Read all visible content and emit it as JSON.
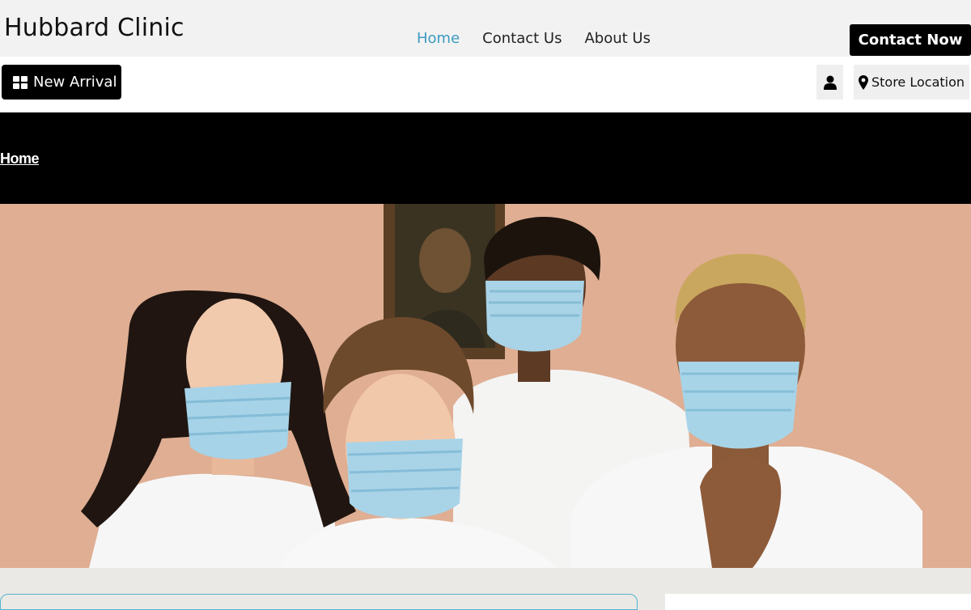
{
  "header": {
    "brand": "Hubbard Clinic",
    "nav": [
      {
        "label": "Home",
        "active": true
      },
      {
        "label": "Contact Us",
        "active": false
      },
      {
        "label": "About Us",
        "active": false
      }
    ],
    "contact_now_label": "Contact Now"
  },
  "subbar": {
    "new_arrival_label": "New Arrival",
    "new_arrival_icon": "grid-icon",
    "account_icon": "user-icon",
    "store_location_label": "Store Location",
    "store_location_icon": "map-marker-icon"
  },
  "banner": {
    "breadcrumb": "Home"
  },
  "hero": {
    "image": "photo-four-people-wearing-face-masks"
  },
  "colors": {
    "accent": "#3a9bc1",
    "topbar_bg": "#f2f2f2",
    "banner_bg": "#000000",
    "button_bg": "#000000"
  }
}
